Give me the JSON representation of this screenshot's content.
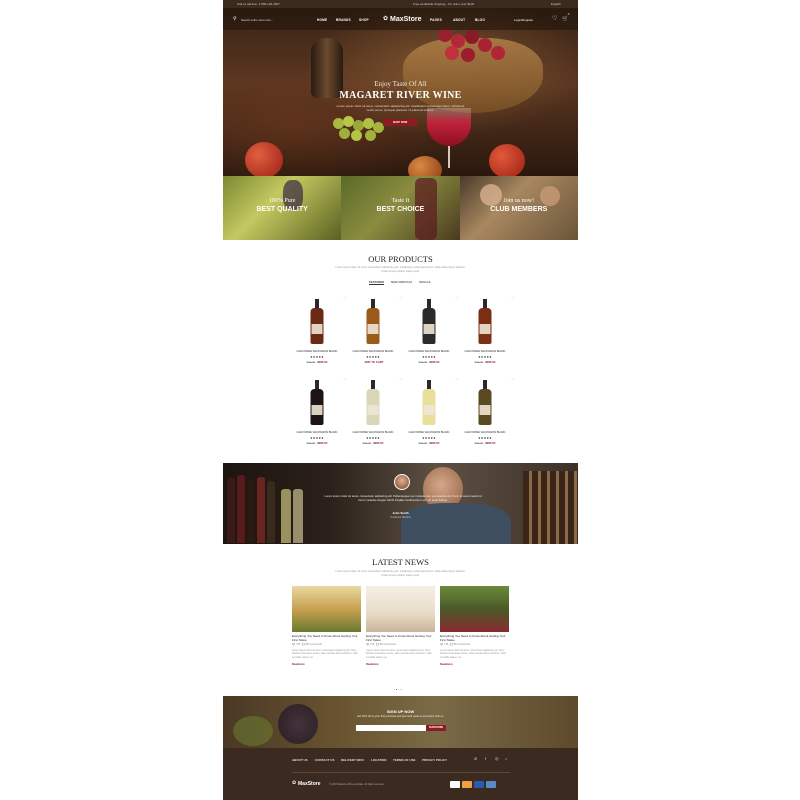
{
  "topbar": {
    "contact": "Call us toll free: 1-555-123-4567",
    "shipping": "Free worldwide shipping - On order over $100",
    "language": "English"
  },
  "header": {
    "search_placeholder": "Search entire store here...",
    "brand": "MaxStore",
    "nav_left": [
      "HOME",
      "BRANDS",
      "SHOP"
    ],
    "nav_right": [
      "PAGES",
      "ABOUT",
      "BLOG"
    ],
    "login": "Login/Register",
    "cart_count": "0"
  },
  "hero": {
    "subtitle": "Enjoy Taste Of All",
    "title": "MAGARET RIVER WINE",
    "description": "Lorem ipsum dolor sit amet, consectetur adipisicing elit. Vestibulum scelerisque libero. Adiubetur nostri purus. Quisque placerat. Ut placerat tempus.",
    "button": "SHOP NOW"
  },
  "banners": [
    {
      "small": "100% Pure",
      "big": "BEST QUALITY"
    },
    {
      "small": "Taste It",
      "big": "BEST CHOICE"
    },
    {
      "small": "Join us now!",
      "big": "CLUB MEMBERS"
    }
  ],
  "products_section": {
    "title": "OUR PRODUCTS",
    "description": "Lorem ipsum dolor sit amet, consectetur adipisicing elit. Vestibulum scelerisque libero. Vitae ullamcorper dapibus. Nulla cursus porttitor sapien velit.",
    "tabs": [
      "FEATURED",
      "NEW ARRIVALS",
      "ONSALE"
    ],
    "items": [
      {
        "name": "CALIFORNIA SAUVIGNON BLANC",
        "stars": "★★★★★",
        "old": "$99.00",
        "price": "$280.00",
        "color": "#6b2a14"
      },
      {
        "name": "CALIFORNIA SAUVIGNON BLANC",
        "stars": "★★★★★",
        "old": "",
        "price": "ADD TO CART",
        "color": "#9a5a1a"
      },
      {
        "name": "CALIFORNIA SAUVIGNON BLANC",
        "stars": "★★★★★",
        "old": "$99.00",
        "price": "$280.00",
        "color": "#2b2b2b"
      },
      {
        "name": "CALIFORNIA SAUVIGNON BLANC",
        "stars": "★★★★★",
        "old": "$99.00",
        "price": "$280.00",
        "color": "#7a2e12"
      },
      {
        "name": "CALIFORNIA SAUVIGNON BLANC",
        "stars": "★★★★★",
        "old": "$99.00",
        "price": "$280.00",
        "color": "#1e1416"
      },
      {
        "name": "CALIFORNIA SAUVIGNON BLANC",
        "stars": "★★★★★",
        "old": "$99.00",
        "price": "$280.00",
        "color": "#d9d7b8"
      },
      {
        "name": "CALIFORNIA SAUVIGNON BLANC",
        "stars": "★★★★★",
        "old": "$99.00",
        "price": "$280.00",
        "color": "#e8df9a"
      },
      {
        "name": "CALIFORNIA SAUVIGNON BLANC",
        "stars": "★★★★★",
        "old": "$99.00",
        "price": "$280.00",
        "color": "#5a4a22"
      }
    ]
  },
  "testimonial": {
    "quote": "Lorem ipsum dolor sit amet, consectetur adipiscing elit. Pellentesque nec molestie dui, sed gravida dui. Nunc sit amet mauris id lorem molestie feugiat. Morbi fringilla condimentum orci, sit amet finibus.",
    "author": "John Smith",
    "role": "Customer Review"
  },
  "news_section": {
    "title": "LATEST NEWS",
    "description": "Lorem ipsum dolor sit amet, consectetur adipisicing elit. Vestibulum scelerisque libero. Vitae ullamcorper dapibus. Nulla cursus porttitor sapien velit.",
    "posts": [
      {
        "title": "Everything You Need to Know About Getting Your First Tattoo",
        "views": "726",
        "comments": "56 Comments",
        "desc": "Lorem ipsum dolor sit amet, consectetur adipiscing elit. Nunc facilisis scelerisque lectus, vitae molestie lacus interdum. Nam convallis sapien vel.",
        "more": "Readmore"
      },
      {
        "title": "Everything You Need to Know About Getting Your First Tattoo",
        "views": "726",
        "comments": "56 Comments",
        "desc": "Lorem ipsum dolor sit amet, consectetur adipiscing elit. Nunc facilisis scelerisque lectus, vitae molestie lacus interdum. Nam convallis sapien vel.",
        "more": "Readmore"
      },
      {
        "title": "Everything You Need to Know About Getting Your First Tattoo",
        "views": "726",
        "comments": "56 Comments",
        "desc": "Lorem ipsum dolor sit amet, consectetur adipiscing elit. Nunc facilisis scelerisque lectus, vitae molestie lacus interdum. Nam convallis sapien vel.",
        "more": "Readmore"
      }
    ]
  },
  "signup": {
    "title": "SIGN UP NOW",
    "desc": "Get 10% off on your first purchase and get more news to promotion Visit us.",
    "button": "SUBSCRIBE"
  },
  "footer": {
    "links": [
      "ABOUT US",
      "CONTACT US",
      "DELIVERY INFO",
      "LOCATION",
      "TERMS OF USE",
      "PRIVACY POLICY"
    ],
    "brand": "MaxStore",
    "copyright": "© 2016 Maxstore Wine template. All rights reserved.",
    "payment_icons": [
      "paypal-icon",
      "mastercard-icon",
      "visa-icon",
      "amex-icon"
    ]
  }
}
